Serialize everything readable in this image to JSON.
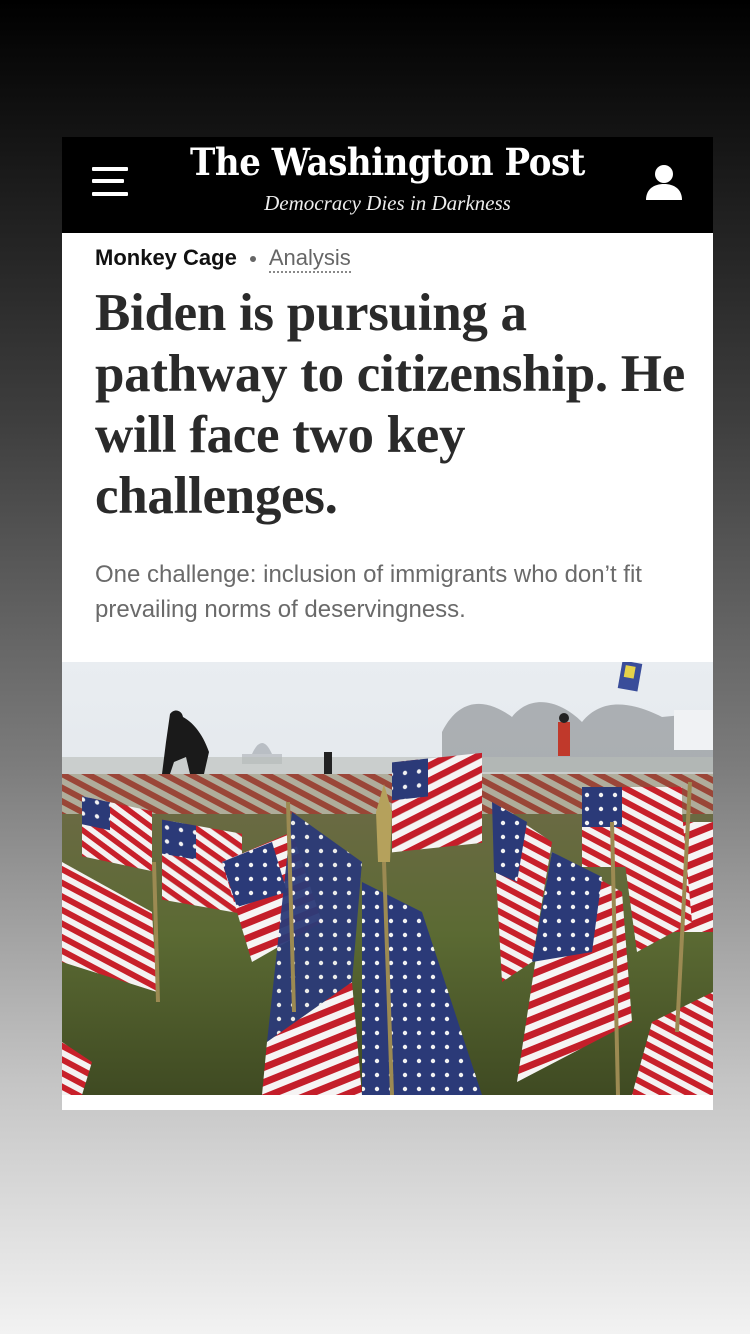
{
  "masthead": {
    "logo": "The Washington Post",
    "tagline": "Democracy Dies in Darkness",
    "menu_icon": "hamburger-menu-icon",
    "account_icon": "user-account-icon"
  },
  "article": {
    "section": "Monkey Cage",
    "label": "Analysis",
    "headline": "Biden is pursuing a pathway to citizenship. He will face two key challenges.",
    "deck": "One challenge: inclusion of immigrants who don’t fit prevailing norms of deservingness."
  },
  "photo": {
    "subject": "flags-photo"
  }
}
